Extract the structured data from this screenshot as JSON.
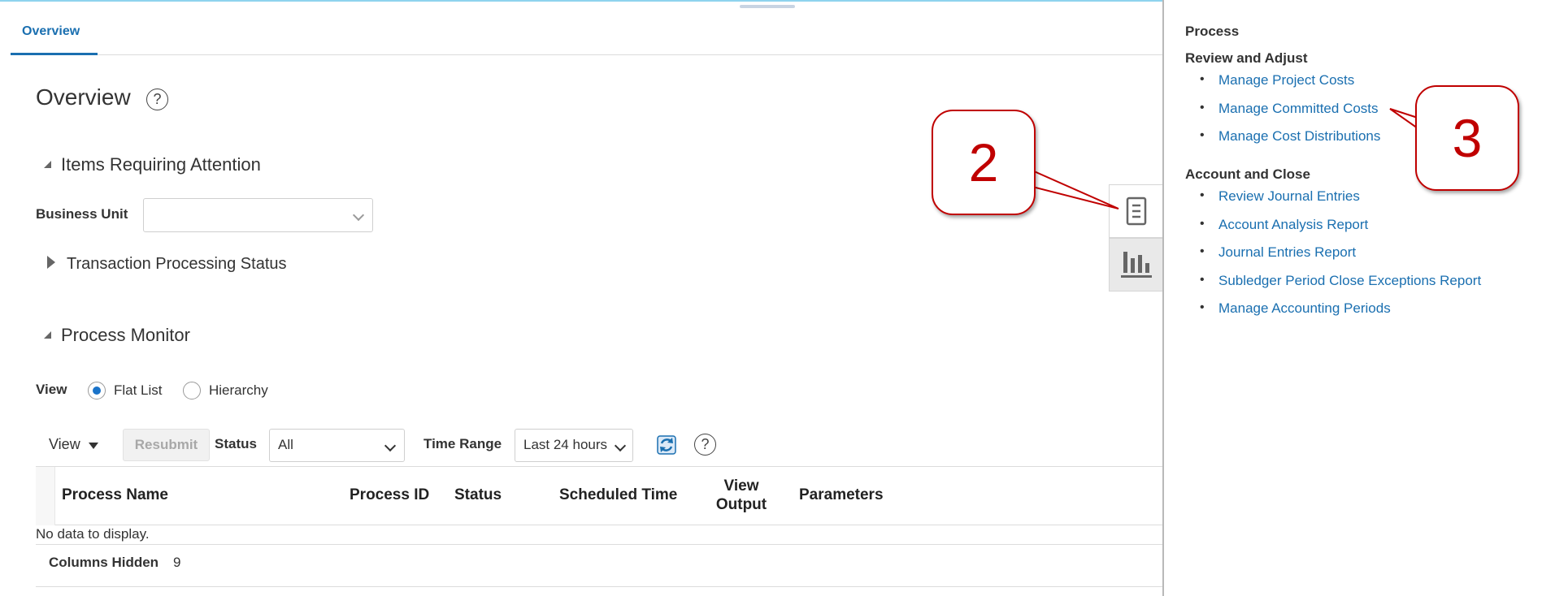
{
  "tabs": [
    {
      "label": "Overview",
      "active": true
    }
  ],
  "page": {
    "title": "Overview"
  },
  "sections": {
    "attention": {
      "title": "Items Requiring Attention",
      "business_unit_label": "Business Unit",
      "business_unit_value": ""
    },
    "transaction": {
      "title": "Transaction Processing Status"
    },
    "monitor": {
      "title": "Process Monitor",
      "view_label": "View",
      "view_options": [
        {
          "label": "Flat List",
          "selected": true
        },
        {
          "label": "Hierarchy",
          "selected": false
        }
      ],
      "toolbar": {
        "view_menu": "View",
        "resubmit": "Resubmit",
        "status_label": "Status",
        "status_value": "All",
        "time_range_label": "Time Range",
        "time_range_value": "Last 24 hours"
      },
      "columns": [
        "Process Name",
        "Process ID",
        "Status",
        "Scheduled Time",
        "View Output",
        "Parameters"
      ],
      "empty_text": "No data to display.",
      "columns_hidden_label": "Columns Hidden",
      "columns_hidden_count": "9"
    }
  },
  "panel": {
    "title": "Process",
    "groups": [
      {
        "title": "Review and Adjust",
        "items": [
          "Manage Project Costs",
          "Manage Committed Costs",
          "Manage Cost Distributions"
        ]
      },
      {
        "title": "Account and Close",
        "items": [
          "Review Journal Entries",
          "Account Analysis Report",
          "Journal Entries Report",
          "Subledger Period Close Exceptions Report",
          "Manage Accounting Periods"
        ]
      }
    ]
  },
  "callouts": [
    "2",
    "3"
  ],
  "icons": [
    "help-icon",
    "refresh-icon",
    "tasks-icon",
    "analytics-icon"
  ],
  "colors": {
    "link": "#1a6fb0",
    "callout": "#c00000",
    "accent": "#1a73c9"
  }
}
